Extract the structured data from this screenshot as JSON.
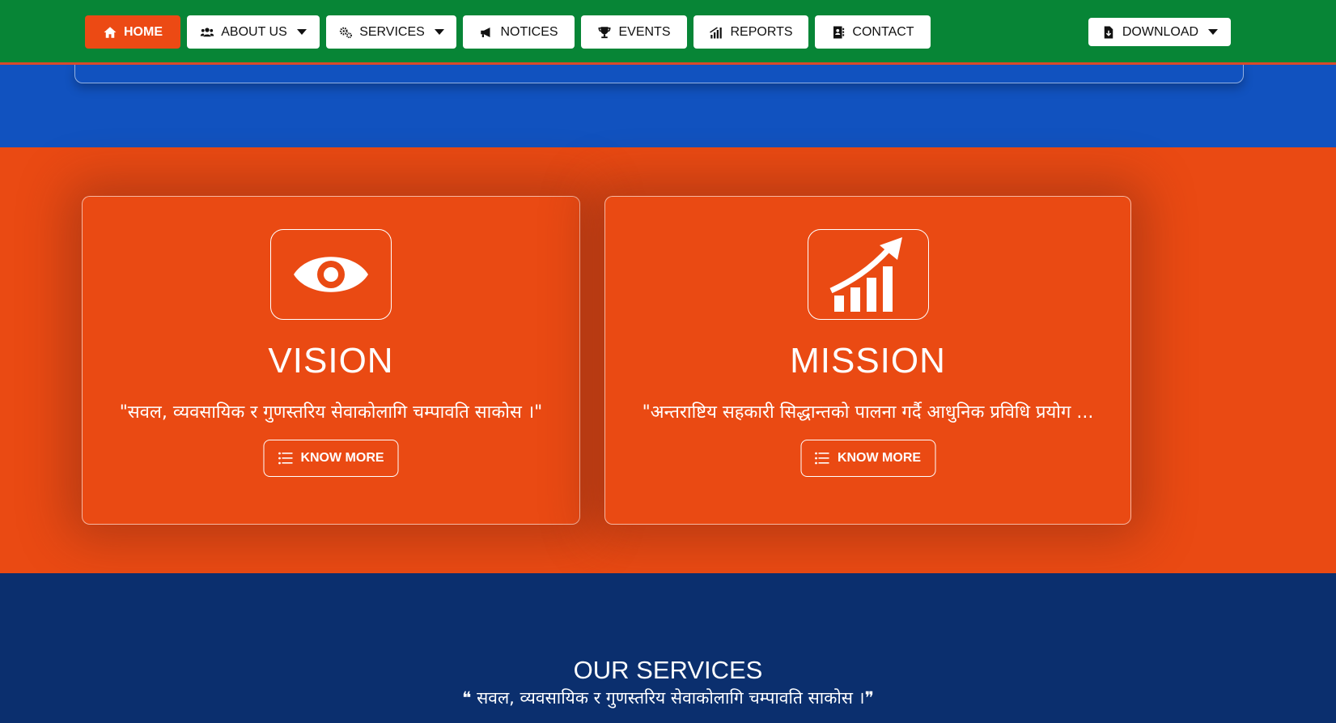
{
  "nav": {
    "home": "HOME",
    "about": "ABOUT US",
    "services": "SERVICES",
    "notices": "NOTICES",
    "events": "EVENTS",
    "reports": "REPORTS",
    "contact": "CONTACT",
    "download": "DOWNLOAD"
  },
  "colors": {
    "nav_bg": "#078536",
    "accent": "#ec4a14",
    "blue_band": "#1152bf",
    "orange_band": "#ea4a13",
    "services_bg": "#0b2f6e"
  },
  "vision": {
    "icon": "eye-icon",
    "title": "VISION",
    "text": "\"सवल, व्यवसायिक र गुणस्तरिय सेवाकोलागि चम्पावति साकोस ।\"",
    "button": "KNOW MORE"
  },
  "mission": {
    "icon": "growth-chart-icon",
    "title": "MISSION",
    "text": "\"अन्तराष्टिय सहकारी सिद्धान्तको पालना गर्दै आधुनिक प्रविधि प्रयोग ...",
    "button": "KNOW MORE"
  },
  "services": {
    "title": "OUR SERVICES",
    "subtitle": "❝ सवल, व्यवसायिक र गुणस्तरिय सेवाकोलागि चम्पावति साकोस ।❞"
  }
}
